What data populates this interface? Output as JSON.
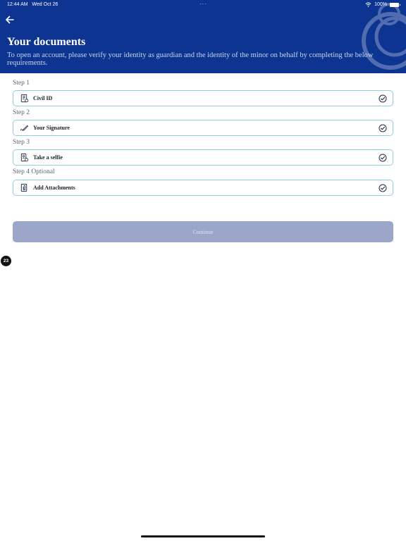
{
  "status_bar": {
    "time": "12:44 AM",
    "date": "Wed Oct 26",
    "dots": "···",
    "battery": "100%"
  },
  "header": {
    "title": "Your documents",
    "subtitle": "To open an account, please verify your identity as guardian and the identity of the minor on behalf by completing the below requirements."
  },
  "steps": [
    {
      "step": "Step 1",
      "label": "Civil ID",
      "icon": "id-card-icon",
      "completed": true
    },
    {
      "step": "Step 2",
      "label": "Your Signature",
      "icon": "signature-pen-icon",
      "completed": true
    },
    {
      "step": "Step 3",
      "label": "Take a selfie",
      "icon": "selfie-icon",
      "completed": true
    },
    {
      "step": "Step 4 Optional",
      "label": "Add Attachments",
      "icon": "attachment-icon",
      "completed": true
    }
  ],
  "continue_label": "Continue",
  "badge_count": "23",
  "colors": {
    "header_bg": "#0d3490",
    "card_border": "#8fd0df",
    "button_disabled": "#9ca6c9",
    "check": "#1f2a44"
  }
}
